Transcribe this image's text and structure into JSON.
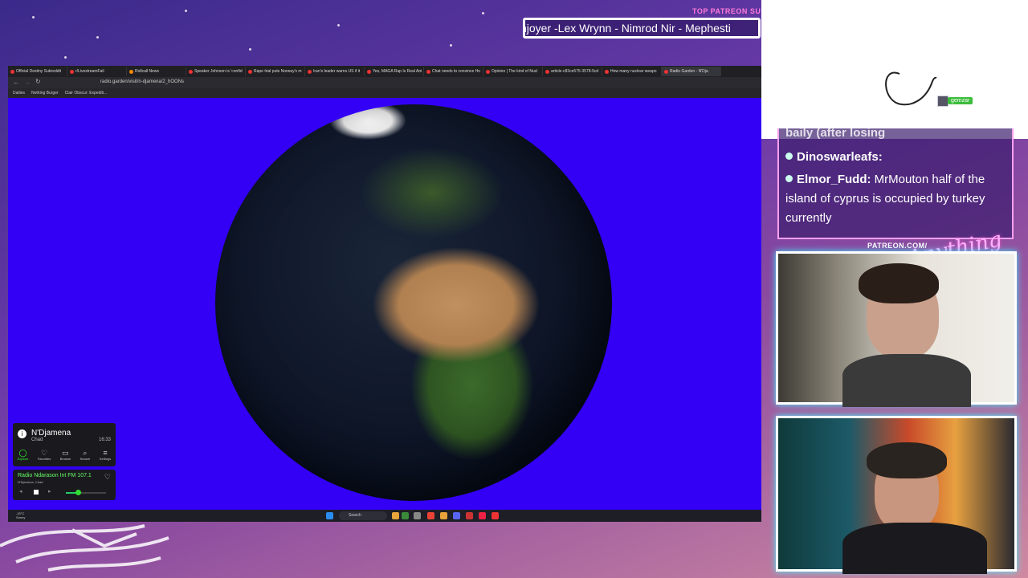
{
  "overlay": {
    "patreon_title": "TOP PATREON SUBS",
    "patreon_ticker": "njoyer -Lex Wrynn - Nimrod Nir - Mephesti",
    "patreon_url": "PATREON.COM/",
    "logo_text": "Anything Else",
    "drawer_name": "gemzar",
    "chat": [
      {
        "user": "baily (after losing",
        "message": ""
      },
      {
        "user": "Dinoswarleafs:",
        "message": ""
      },
      {
        "user": "Elmor_Fudd:",
        "message": "MrMouton half of the island of cyprus is occupied by turkey currently"
      }
    ]
  },
  "browser": {
    "tabs": [
      {
        "label": "Official Destiny Subreddit"
      },
      {
        "label": "r/LivestreamFail"
      },
      {
        "label": "Rollcall News",
        "highlight": true
      },
      {
        "label": "Speaker Johnson is 'confid"
      },
      {
        "label": "Rape trial puts Norway's m"
      },
      {
        "label": "Iran's leader warns US if it"
      },
      {
        "label": "Yes, MAGA Rap Is Real Ani"
      },
      {
        "label": "Chat needs to convince Ho"
      },
      {
        "label": "Opinion | The kind of Nucl"
      },
      {
        "label": "article-c83ce575-3578-5cd"
      },
      {
        "label": "How many nuclear weapo"
      },
      {
        "label": "Radio Garden - N'Dja",
        "active": true
      }
    ],
    "url": "radio.garden/visit/n-djamena/2_hOONs",
    "bookmarks": [
      "Dailies",
      "Nothing Burger",
      "Clair Obscur: Expediti..."
    ],
    "taskbar": {
      "search_label": "Search",
      "weather_temp": "-15°C",
      "weather_desc": "Sunny"
    }
  },
  "radio_garden": {
    "city": "N'Djamena",
    "country": "Chad",
    "time": "16:33",
    "nav": [
      {
        "label": "Explore",
        "icon": "explore-icon",
        "active": true
      },
      {
        "label": "Favorites",
        "icon": "heart-icon"
      },
      {
        "label": "Browse",
        "icon": "map-icon"
      },
      {
        "label": "Search",
        "icon": "search-icon"
      },
      {
        "label": "Settings",
        "icon": "menu-icon"
      }
    ],
    "now_playing": "Radio Ndarason Int FM 107.1",
    "now_playing_location": "N'Djamena, Chad",
    "volume_fraction": 0.3
  }
}
